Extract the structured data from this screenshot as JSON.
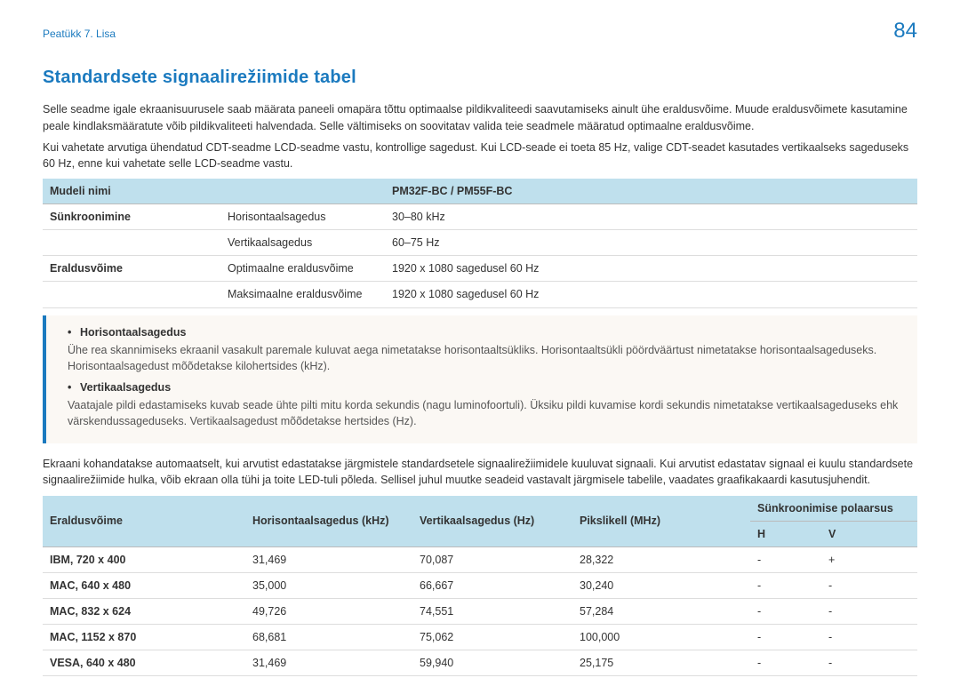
{
  "header": {
    "breadcrumb": "Peatükk 7. Lisa",
    "page_number": "84"
  },
  "section": {
    "title": "Standardsete signaalirežiimide tabel",
    "p1": "Selle seadme igale ekraanisuurusele saab määrata paneeli omapära tõttu optimaalse pildikvaliteedi saavutamiseks ainult ühe eraldusvõime. Muude eraldusvõimete kasutamine peale kindlaksmääratute võib pildikvaliteeti halvendada. Selle vältimiseks on soovitatav valida teie seadmele määratud optimaalne eraldusvõime.",
    "p2": "Kui vahetate arvutiga ühendatud CDT-seadme LCD-seadme vastu, kontrollige sagedust. Kui LCD-seade ei toeta 85 Hz, valige CDT-seadet kasutades vertikaalseks sageduseks 60 Hz, enne kui vahetate selle LCD-seadme vastu."
  },
  "table1": {
    "head": {
      "model_label": "Mudeli nimi",
      "model_value": "PM32F-BC / PM55F-BC"
    },
    "rows": [
      {
        "a": "Sünkroonimine",
        "b": "Horisontaalsagedus",
        "c": "30–80 kHz"
      },
      {
        "a": "",
        "b": "Vertikaalsagedus",
        "c": "60–75 Hz"
      },
      {
        "a": "Eraldusvõime",
        "b": "Optimaalne eraldusvõime",
        "c": "1920 x 1080 sagedusel 60 Hz"
      },
      {
        "a": "",
        "b": "Maksimaalne eraldusvõime",
        "c": "1920 x 1080 sagedusel 60 Hz"
      }
    ]
  },
  "infobox": {
    "items": [
      {
        "term": "Horisontaalsagedus",
        "def": "Ühe rea skannimiseks ekraanil vasakult paremale kuluvat aega nimetatakse horisontaaltsükliks. Horisontaaltsükli pöördväärtust nimetatakse horisontaalsageduseks. Horisontaalsagedust mõõdetakse kilohertsides (kHz)."
      },
      {
        "term": "Vertikaalsagedus",
        "def": "Vaatajale pildi edastamiseks kuvab seade ühte pilti mitu korda sekundis (nagu luminofoortuli). Üksiku pildi kuvamise kordi sekundis nimetatakse vertikaalsageduseks ehk värskendussageduseks. Vertikaalsagedust mõõdetakse hertsides (Hz)."
      }
    ]
  },
  "midpara": "Ekraani kohandatakse automaatselt, kui arvutist edastatakse järgmistele standardsetele signaalirežiimidele kuuluvat signaali. Kui arvutist edastatav signaal ei kuulu standardsete signaalirežiimide hulka, võib ekraan olla tühi ja toite LED-tuli põleda. Sellisel juhul muutke seadeid vastavalt järgmisele tabelile, vaadates graafikakaardi kasutusjuhendit.",
  "table2": {
    "head": {
      "res": "Eraldusvõime",
      "hf": "Horisontaalsagedus (kHz)",
      "vf": "Vertikaalsagedus (Hz)",
      "pc": "Pikslikell (MHz)",
      "pol": "Sünkroonimise polaarsus",
      "h": "H",
      "v": "V"
    },
    "rows": [
      {
        "res": "IBM, 720 x 400",
        "hf": "31,469",
        "vf": "70,087",
        "pc": "28,322",
        "h": "-",
        "v": "+"
      },
      {
        "res": "MAC, 640 x 480",
        "hf": "35,000",
        "vf": "66,667",
        "pc": "30,240",
        "h": "-",
        "v": "-"
      },
      {
        "res": "MAC, 832 x 624",
        "hf": "49,726",
        "vf": "74,551",
        "pc": "57,284",
        "h": "-",
        "v": "-"
      },
      {
        "res": "MAC, 1152 x 870",
        "hf": "68,681",
        "vf": "75,062",
        "pc": "100,000",
        "h": "-",
        "v": "-"
      },
      {
        "res": "VESA, 640 x 480",
        "hf": "31,469",
        "vf": "59,940",
        "pc": "25,175",
        "h": "-",
        "v": "-"
      }
    ]
  }
}
